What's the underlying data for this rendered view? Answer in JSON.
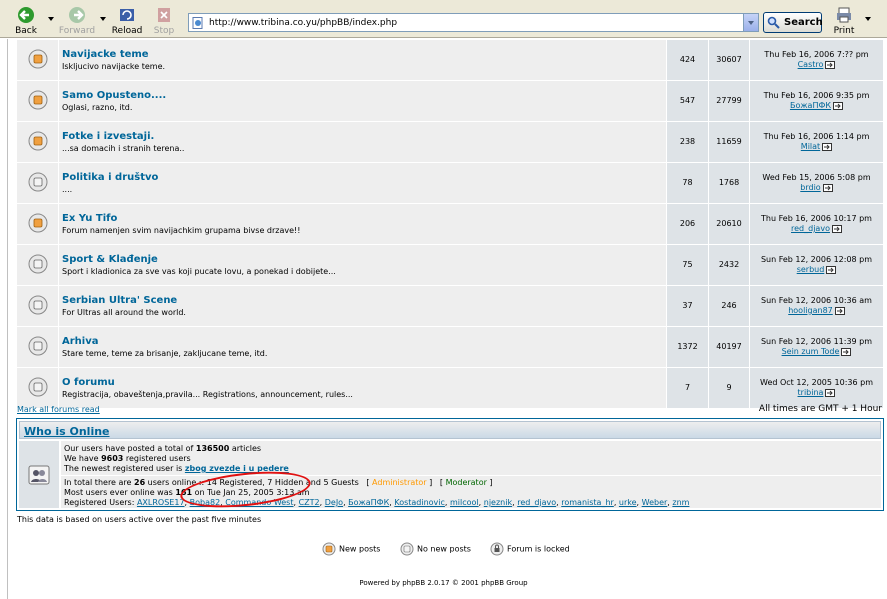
{
  "browser": {
    "back_label": "Back",
    "forward_label": "Forward",
    "reload_label": "Reload",
    "stop_label": "Stop",
    "address": "http://www.tribina.co.yu/phpBB/index.php",
    "search_label": "Search",
    "print_label": "Print"
  },
  "forums": [
    {
      "name": "Navijacke teme",
      "desc": "Iskljucivo navijacke teme.",
      "topics": "424",
      "posts": "30607",
      "last_date": "Thu Feb 16, 2006 7:?? pm",
      "last_user": "Castro",
      "new": true
    },
    {
      "name": "Samo Opusteno....",
      "desc": "Oglasi, razno, itd.",
      "topics": "547",
      "posts": "27799",
      "last_date": "Thu Feb 16, 2006 9:35 pm",
      "last_user": "БожаПФК",
      "new": true
    },
    {
      "name": "Fotke i izvestaji.",
      "desc": "...sa domacih i stranih terena..",
      "topics": "238",
      "posts": "11659",
      "last_date": "Thu Feb 16, 2006 1:14 pm",
      "last_user": "Milat",
      "new": true
    },
    {
      "name": "Politika i društvo",
      "desc": "....",
      "topics": "78",
      "posts": "1768",
      "last_date": "Wed Feb 15, 2006 5:08 pm",
      "last_user": "brdio",
      "new": false
    },
    {
      "name": "Ex Yu Tifo",
      "desc": "Forum namenjen svim navijachkim grupama bivse drzave!!",
      "topics": "206",
      "posts": "20610",
      "last_date": "Thu Feb 16, 2006 10:17 pm",
      "last_user": "red_djavo",
      "new": true
    },
    {
      "name": "Sport & Klađenje",
      "desc": "Sport i kladionica za sve vas koji pucate lovu, a ponekad i dobijete...",
      "topics": "75",
      "posts": "2432",
      "last_date": "Sun Feb 12, 2006 12:08 pm",
      "last_user": "serbud",
      "new": false
    },
    {
      "name": "Serbian Ultra' Scene",
      "desc": "For Ultras all around the world.",
      "topics": "37",
      "posts": "246",
      "last_date": "Sun Feb 12, 2006 10:36 am",
      "last_user": "hooligan87",
      "new": false
    },
    {
      "name": "Arhiva",
      "desc": "Stare teme, teme za brisanje, zakljucane teme, itd.",
      "topics": "1372",
      "posts": "40197",
      "last_date": "Sun Feb 12, 2006 11:39 pm",
      "last_user": "Sein zum Tode",
      "new": false
    },
    {
      "name": "O forumu",
      "desc": "Registracija, obaveštenja,pravila... Registrations, announcement, rules...",
      "topics": "7",
      "posts": "9",
      "last_date": "Wed Oct 12, 2005 10:36 pm",
      "last_user": "tribina",
      "new": false
    }
  ],
  "mark_all": "Mark all forums read",
  "timezone": "All times are GMT + 1 Hour",
  "who": {
    "title": "Who is Online",
    "posted_pre": "Our users have posted a total of ",
    "posted_count": "136500",
    "posted_post": " articles",
    "have_pre": "We have ",
    "have_count": "9603",
    "have_post": " registered users",
    "newest_pre": "The newest registered user is ",
    "newest_user": "zbog zvezde i u pedere",
    "total_pre": "In total there are ",
    "total_count": "26",
    "total_post": " users online :: 14 Registered, 7 Hidden and 5 Guests",
    "admin_label": "Administrator",
    "mod_label": "Moderator",
    "most_pre": "Most users ever online was ",
    "most_count": "161",
    "most_post": " on Tue Jan 25, 2005 3:13 am",
    "registered_label": "Registered Users: ",
    "registered_users": [
      "AXLROSE17",
      "Boba82",
      "Commando West",
      "CZT2",
      "DeJo",
      "БожаПФК",
      "Kostadinovic",
      "milcool",
      "njeznik",
      "red_djavo",
      "romanista_hr",
      "urke",
      "Weber",
      "znm"
    ]
  },
  "based_note": "This data is based on users active over the past five minutes",
  "legend": {
    "new_posts": "New posts",
    "no_new_posts": "No new posts",
    "locked": "Forum is locked"
  },
  "powered_by": "Powered by phpBB 2.0.17 © 2001 phpBB Group",
  "colors": {
    "link": "#006699",
    "row_light": "#eeeeee",
    "row_dark": "#dee3e7",
    "admin": "#ff9900",
    "moderator": "#006600",
    "annotation": "#e01010"
  }
}
